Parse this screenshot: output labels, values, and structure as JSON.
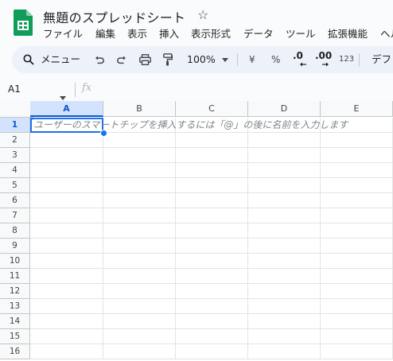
{
  "doc": {
    "title": "無題のスプレッドシート"
  },
  "menu": [
    "ファイル",
    "編集",
    "表示",
    "挿入",
    "表示形式",
    "データ",
    "ツール",
    "拡張機能",
    "ヘル"
  ],
  "toolbar": {
    "search_label": "メニュー",
    "zoom": "100%",
    "currency": "¥",
    "percent": "%",
    "dec_decrease": ".0",
    "dec_increase": ".00",
    "number_format": "123",
    "font": "デフ"
  },
  "formula_bar": {
    "cell_ref": "A1",
    "fx": "fx",
    "value": ""
  },
  "grid": {
    "columns": [
      "A",
      "B",
      "C",
      "D",
      "E"
    ],
    "rows": [
      "1",
      "2",
      "3",
      "4",
      "5",
      "6",
      "7",
      "8",
      "9",
      "10",
      "11",
      "12",
      "13",
      "14",
      "15",
      "16"
    ],
    "selected_cell": "A1",
    "a1_hint": "ユーザーのスマートチップを挿入するには「@」の後に名前を入力します"
  },
  "colors": {
    "accent": "#1a73e8",
    "sheets_green": "#0f9d58",
    "toolbar_bg": "#edf2fa",
    "selection_bg": "#d3e3fd"
  }
}
